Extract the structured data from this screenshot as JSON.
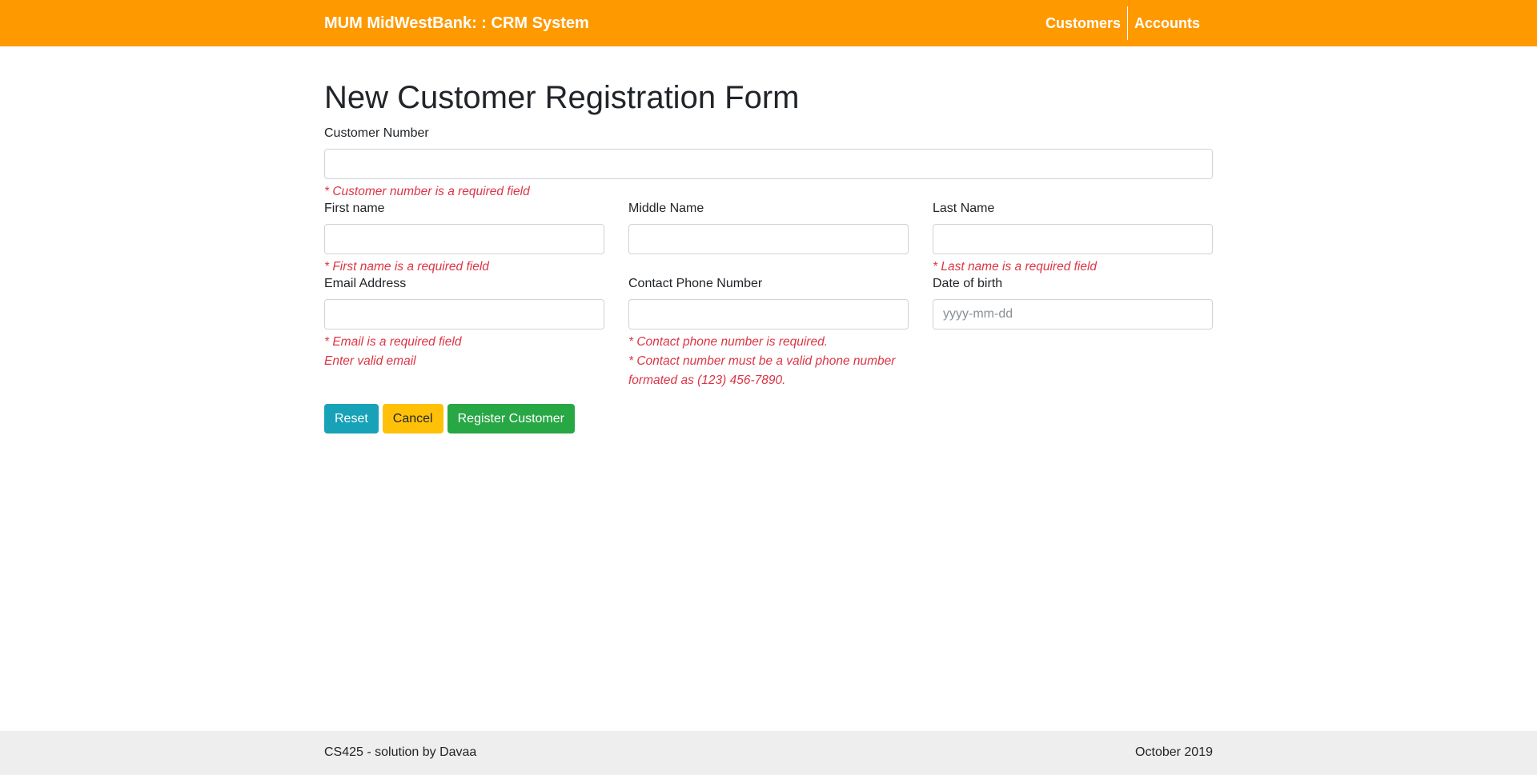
{
  "header": {
    "brand": "MUM MidWestBank: : CRM System",
    "nav": [
      {
        "label": "Customers"
      },
      {
        "label": "Accounts"
      }
    ],
    "background_color": "#ff9900"
  },
  "form": {
    "title": "New Customer Registration Form",
    "customer_number": {
      "label": "Customer Number",
      "value": "",
      "placeholder": "",
      "errors": [
        "* Customer number is a required field"
      ]
    },
    "first_name": {
      "label": "First name",
      "value": "",
      "placeholder": "",
      "errors": [
        "* First name is a required field"
      ]
    },
    "middle_name": {
      "label": "Middle Name",
      "value": "",
      "placeholder": "",
      "errors": []
    },
    "last_name": {
      "label": "Last Name",
      "value": "",
      "placeholder": "",
      "errors": [
        "* Last name is a required field"
      ]
    },
    "email": {
      "label": "Email Address",
      "value": "",
      "placeholder": "",
      "errors": [
        "* Email is a required field",
        "Enter valid email"
      ]
    },
    "phone": {
      "label": "Contact Phone Number",
      "value": "",
      "placeholder": "",
      "errors": [
        "* Contact phone number is required.",
        "* Contact number must be a valid phone number formated as (123) 456-7890."
      ]
    },
    "dob": {
      "label": "Date of birth",
      "value": "",
      "placeholder": "yyyy-mm-dd",
      "errors": []
    },
    "buttons": {
      "reset": "Reset",
      "cancel": "Cancel",
      "register": "Register Customer"
    }
  },
  "footer": {
    "left": "CS425 - solution by Davaa",
    "right": "October 2019"
  },
  "colors": {
    "error": "#dc3545",
    "reset_button": "#17a2b8",
    "cancel_button": "#ffc107",
    "register_button": "#28a745",
    "footer_background": "#eeeeee"
  }
}
